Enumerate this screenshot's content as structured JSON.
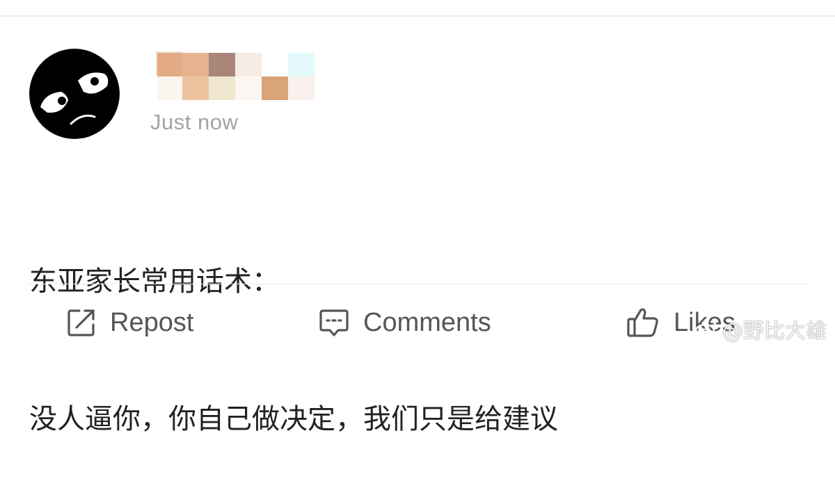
{
  "post": {
    "timestamp": "Just now",
    "text_lines": [
      "东亚家长常用话术：",
      "没人逼你，你自己做决定，我们只是给建议"
    ]
  },
  "avatar": {
    "icon": "annoyed-face-icon"
  },
  "username": {
    "obscured": true
  },
  "actions": {
    "repost_label": "Repost",
    "comments_label": "Comments",
    "likes_label": "Likes"
  },
  "watermark": {
    "text": "@野比大雄"
  },
  "colors": {
    "timestamp": "#a3a3a3",
    "text": "#222222",
    "action": "#555555",
    "divider": "#ededed"
  }
}
